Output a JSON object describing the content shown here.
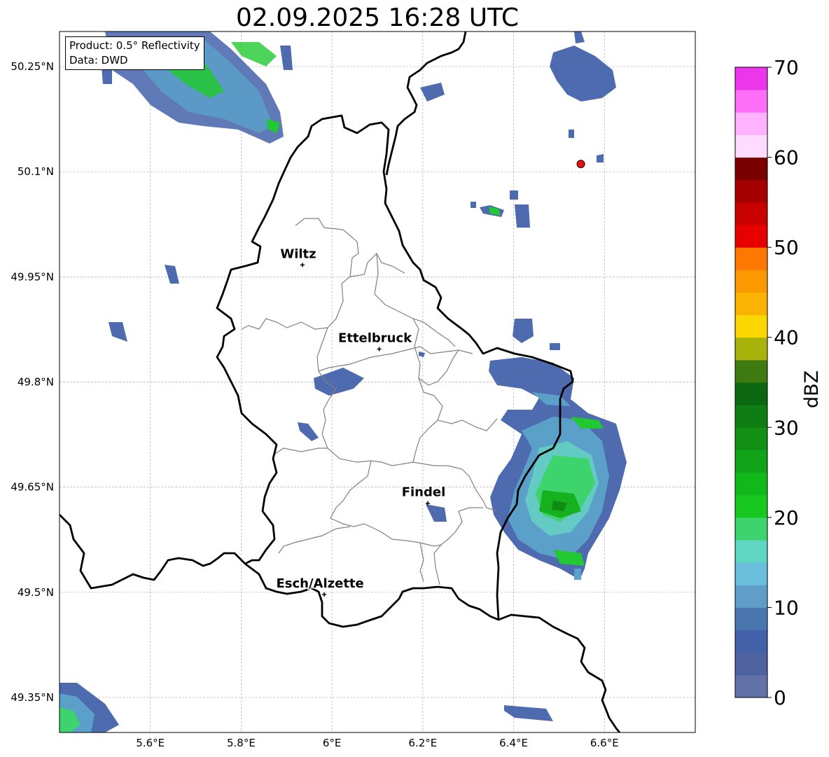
{
  "title": "02.09.2025 16:28 UTC",
  "info_box": {
    "product": "Product: 0.5° Reflectivity",
    "data": "Data: DWD"
  },
  "axes": {
    "lon_ticks": [
      "5.6°E",
      "5.8°E",
      "6°E",
      "6.2°E",
      "6.4°E",
      "6.6°E"
    ],
    "lat_ticks": [
      "50.25°N",
      "50.1°N",
      "49.95°N",
      "49.8°N",
      "49.65°N",
      "49.5°N",
      "49.35°N"
    ],
    "lon_values": [
      5.6,
      5.8,
      6.0,
      6.2,
      6.4,
      6.6
    ],
    "lat_values": [
      50.25,
      50.1,
      49.95,
      49.8,
      49.65,
      49.5,
      49.35
    ],
    "lon_range": [
      5.4,
      6.8
    ],
    "lat_range": [
      49.3,
      50.3
    ],
    "grid": true
  },
  "cities": [
    {
      "name": "Wiltz",
      "lon": 5.935,
      "lat": 49.967
    },
    {
      "name": "Ettelbruck",
      "lon": 6.104,
      "lat": 49.847
    },
    {
      "name": "Findel",
      "lon": 6.211,
      "lat": 49.627
    },
    {
      "name": "Esch/Alzette",
      "lon": 5.983,
      "lat": 49.497
    }
  ],
  "radar_site": {
    "lon": 6.548,
    "lat": 50.111,
    "color": "#e81010"
  },
  "colorbar": {
    "label": "dBZ",
    "ticks": [
      "0",
      "10",
      "20",
      "30",
      "40",
      "50",
      "60",
      "70"
    ],
    "range": [
      0,
      70
    ],
    "colors": [
      "#6272a8",
      "#4f62a0",
      "#4361a8",
      "#4a76b0",
      "#5e9ec8",
      "#6bbedc",
      "#5ed6c2",
      "#3dd46e",
      "#17c81e",
      "#10b81a",
      "#12a418",
      "#119014",
      "#0f7e12",
      "#0c6810",
      "#3e7a10",
      "#aab20c",
      "#fcd600",
      "#fab400",
      "#fc9800",
      "#fc7800",
      "#e60000",
      "#c80000",
      "#a40000",
      "#7a0000",
      "#ffdcff",
      "#ffb2ff",
      "#ff6ef6",
      "#ec36ec"
    ]
  }
}
